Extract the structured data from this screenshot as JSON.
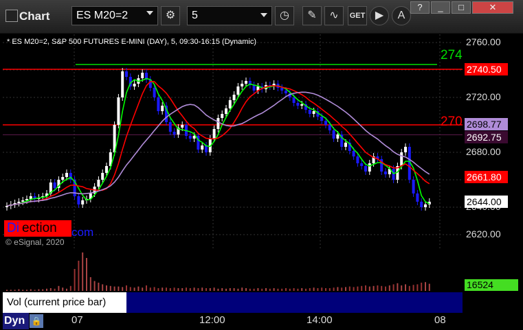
{
  "toolbar": {
    "app_title": "Chart",
    "symbol": "ES M20=2",
    "interval": "5",
    "get_label": "GET"
  },
  "chart_info": "* ES M20=2, S&P 500 FUTURES E-MINI (DAY), 5, 09:30-16:15 (Dynamic)",
  "watermark": {
    "copyright": "© eSignal, 2020",
    "brand_left": "Di",
    "brand_mid": "ection",
    "brand_right": "com"
  },
  "price_axis": {
    "ticks": [
      "2760.00",
      "2740.00",
      "2720.00",
      "2700.00",
      "2680.00",
      "2660.00",
      "2640.00",
      "2620.00"
    ],
    "labels": [
      {
        "text": "2740.50",
        "bg": "#ff0000",
        "fg": "#ffffff"
      },
      {
        "text": "2698.77",
        "bg": "#b08cd8",
        "fg": "#000000"
      },
      {
        "text": "2692.75",
        "bg": "#3a0a30",
        "fg": "#ffffff"
      },
      {
        "text": "2661.80",
        "bg": "#ff0000",
        "fg": "#ffffff"
      },
      {
        "text": "2644.00",
        "bg": "#ffffff",
        "fg": "#000000"
      }
    ]
  },
  "level_labels": {
    "green": "274",
    "red": "270"
  },
  "volume": {
    "value": "16524",
    "study_label": "Vol (current price bar)"
  },
  "time_axis": {
    "labels": [
      "07",
      "12:00",
      "14:00",
      "08"
    ],
    "mode": "Dyn"
  },
  "colors": {
    "up": "#ffffff",
    "down": "#1a1aff",
    "ma_green": "#00ff00",
    "ma_red": "#ff0000",
    "ma_purple": "#b08cd8",
    "level_green": "#00dd00",
    "level_red": "#ff0000"
  },
  "chart_data": {
    "type": "candlestick",
    "y_range": [
      2610,
      2766
    ],
    "levels": {
      "green": 2744,
      "red_top": 2740.5,
      "red_mid": 2700,
      "purple_dark": 2692.75
    },
    "closes": [
      2641,
      2642,
      2643,
      2644,
      2645,
      2646,
      2648,
      2646,
      2647,
      2648,
      2650,
      2658,
      2654,
      2660,
      2662,
      2665,
      2660,
      2648,
      2642,
      2645,
      2646,
      2650,
      2655,
      2660,
      2665,
      2670,
      2680,
      2700,
      2720,
      2739,
      2735,
      2728,
      2730,
      2734,
      2738,
      2733,
      2727,
      2720,
      2710,
      2714,
      2702,
      2695,
      2693,
      2698,
      2700,
      2692,
      2690,
      2692,
      2682,
      2685,
      2680,
      2690,
      2697,
      2705,
      2708,
      2712,
      2718,
      2722,
      2728,
      2730,
      2732,
      2729,
      2725,
      2728,
      2726,
      2729,
      2728,
      2730,
      2727,
      2725,
      2723,
      2720,
      2716,
      2714,
      2715,
      2711,
      2708,
      2710,
      2706,
      2703,
      2700,
      2696,
      2690,
      2693,
      2684,
      2687,
      2681,
      2677,
      2672,
      2670,
      2666,
      2672,
      2677,
      2675,
      2666,
      2664,
      2668,
      2660,
      2670,
      2680,
      2684,
      2660,
      2650,
      2644,
      2640,
      2642,
      2644
    ],
    "volumes": [
      2,
      2,
      2,
      3,
      2,
      2,
      3,
      2,
      3,
      3,
      4,
      5,
      4,
      9,
      6,
      4,
      9,
      40,
      55,
      70,
      60,
      25,
      18,
      15,
      12,
      10,
      9,
      8,
      8,
      7,
      10,
      7,
      6,
      8,
      6,
      10,
      6,
      7,
      5,
      6,
      6,
      5,
      6,
      5,
      5,
      6,
      5,
      6,
      5,
      6,
      5,
      5,
      6,
      4,
      5,
      4,
      5,
      5,
      4,
      6,
      5,
      4,
      4,
      5,
      4,
      5,
      4,
      5,
      4,
      4,
      5,
      4,
      5,
      4,
      5,
      4,
      5,
      6,
      5,
      6,
      5,
      5,
      6,
      7,
      6,
      7,
      8,
      7,
      8,
      9,
      10,
      8,
      9,
      10,
      9,
      8,
      10,
      12,
      14,
      10,
      12,
      9,
      11,
      12,
      15,
      16,
      13
    ],
    "volume_current": 16524,
    "price_labels": [
      2740.5,
      2698.77,
      2692.75,
      2661.8,
      2644.0
    ],
    "time_labels": [
      "07",
      "12:00",
      "14:00",
      "08"
    ]
  }
}
